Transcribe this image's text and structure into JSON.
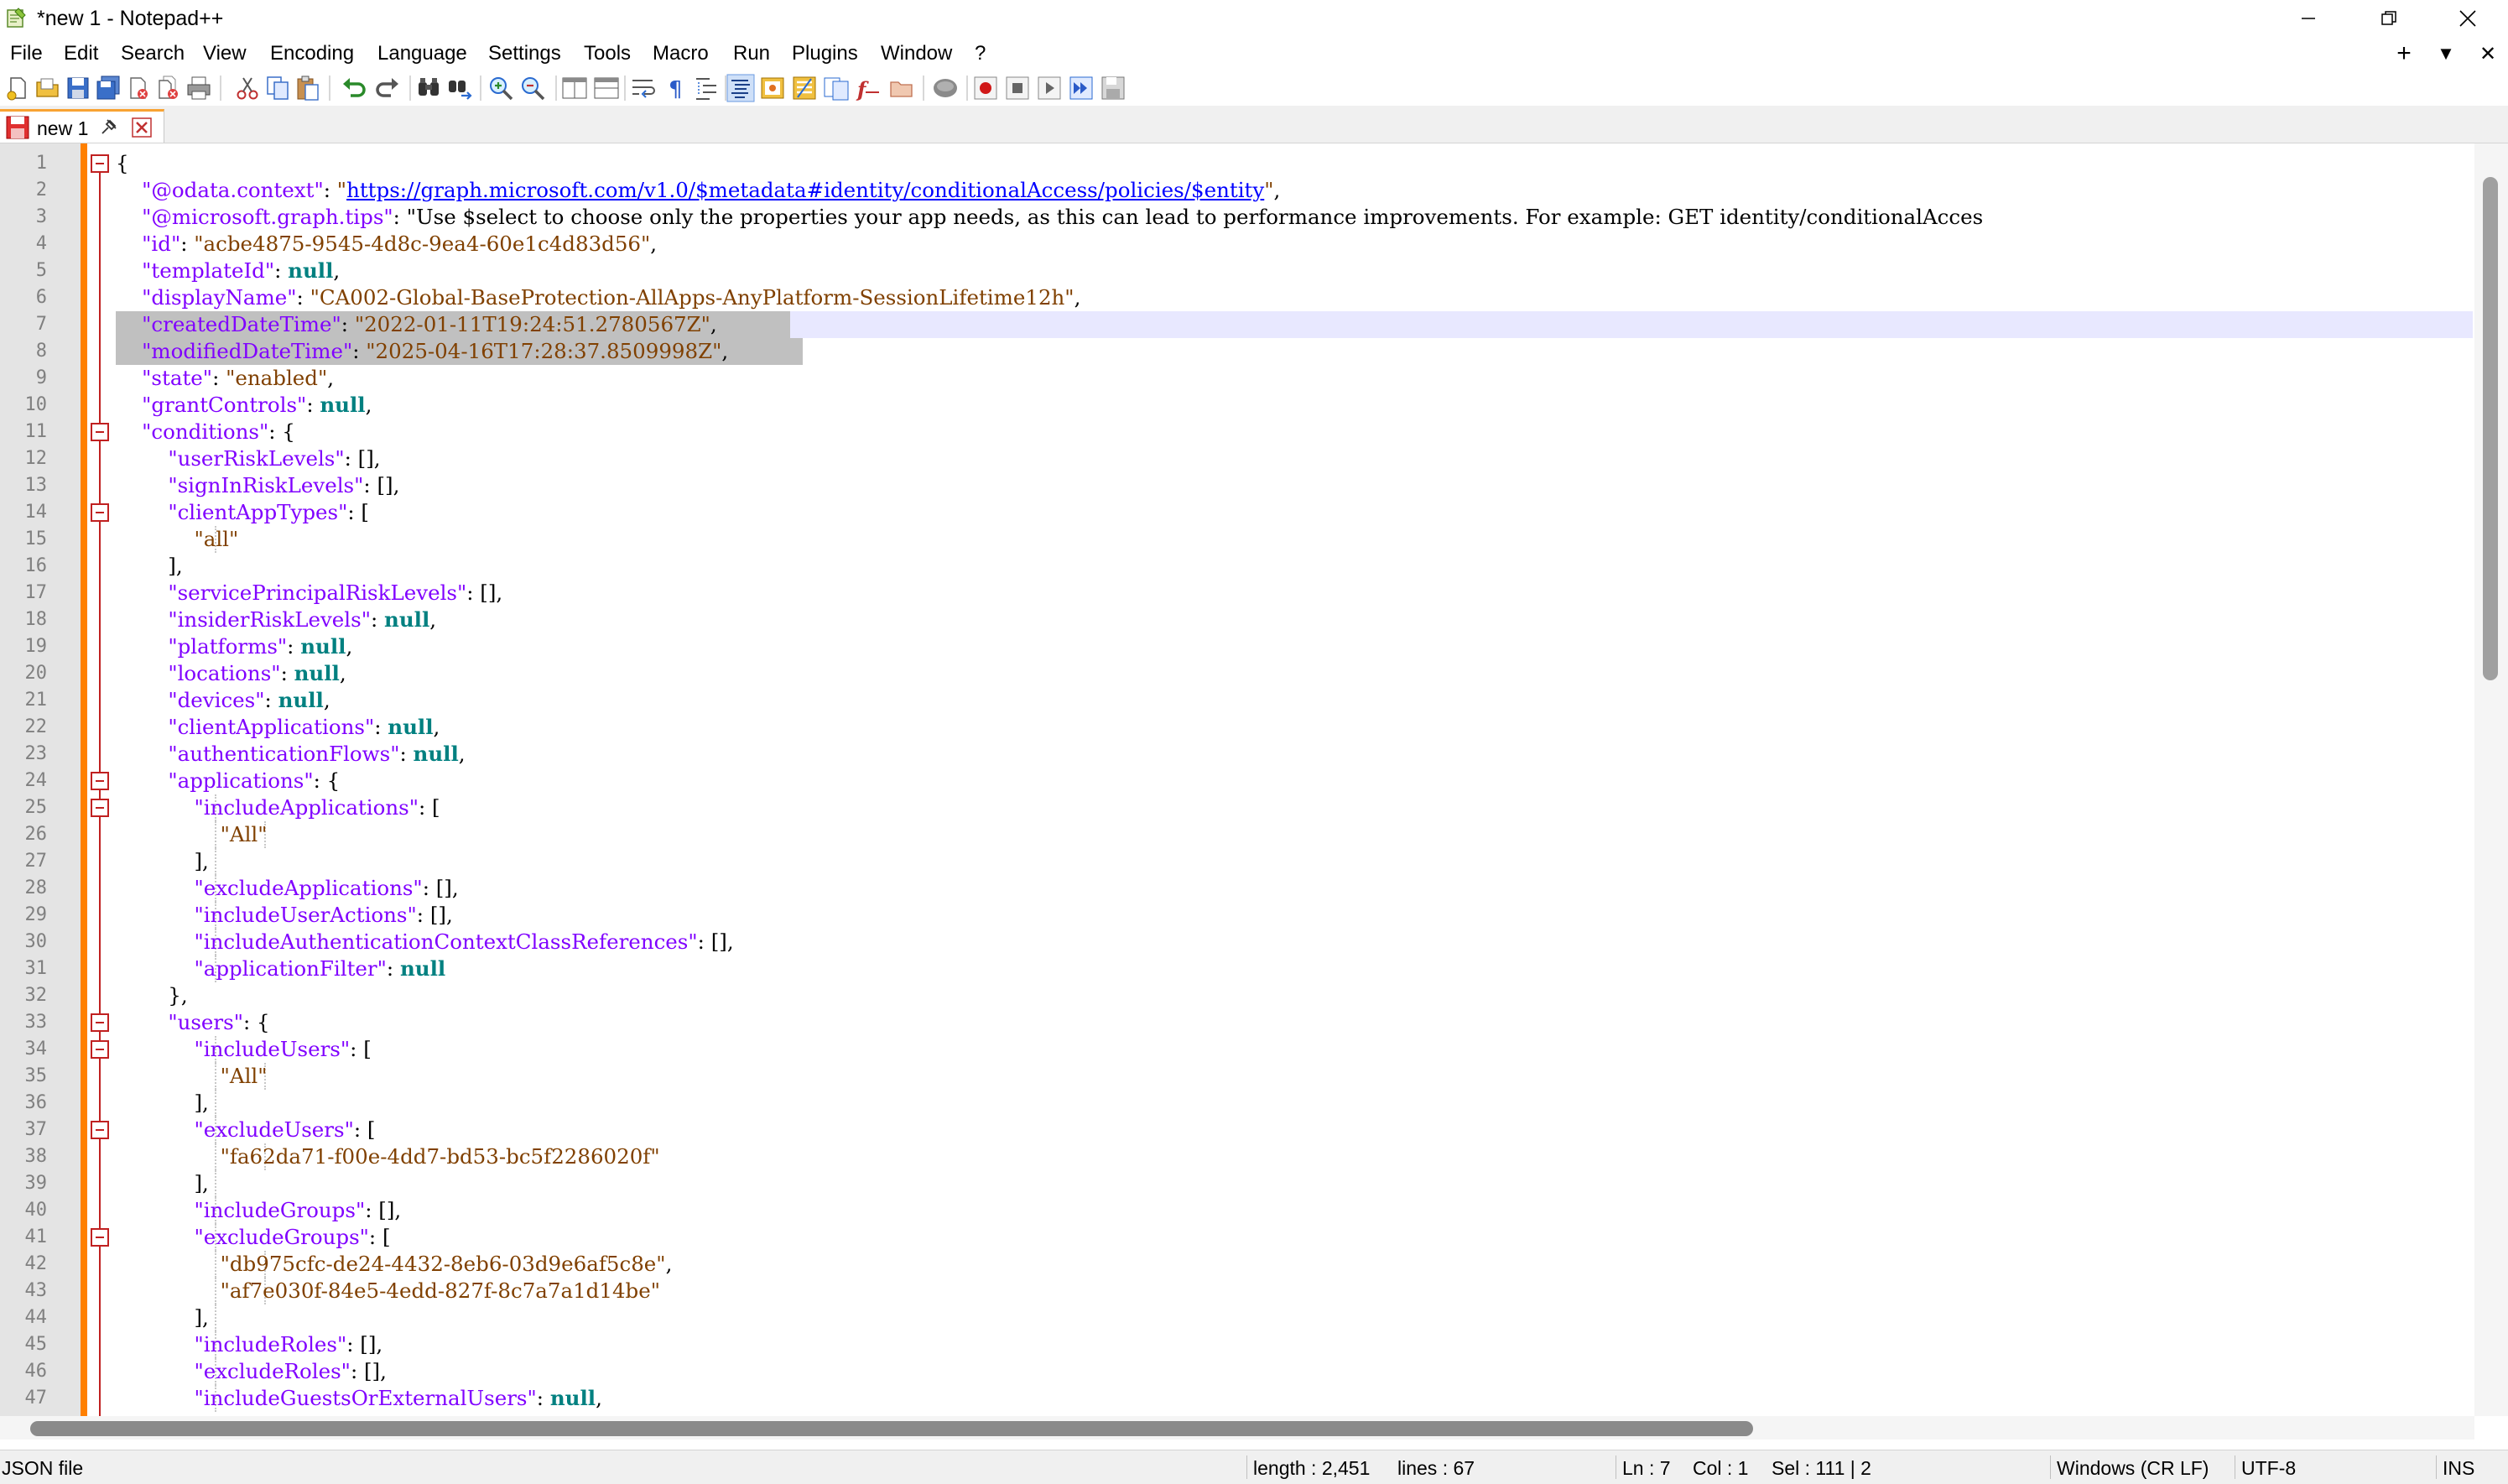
{
  "window": {
    "title": "*new 1 - Notepad++",
    "icon": "notepadpp-icon",
    "controls": [
      "minimize",
      "restore",
      "close"
    ]
  },
  "menu": {
    "items": [
      "File",
      "Edit",
      "Search",
      "View",
      "Encoding",
      "Language",
      "Settings",
      "Tools",
      "Macro",
      "Run",
      "Plugins",
      "Window",
      "?"
    ],
    "right_buttons": [
      "+",
      "▼",
      "✕"
    ]
  },
  "toolbar": {
    "icons": [
      "new-file-icon",
      "open-file-icon",
      "save-icon",
      "save-all-icon",
      "close-icon",
      "close-all-icon",
      "print-icon",
      "cut-icon",
      "copy-icon",
      "paste-icon",
      "undo-icon",
      "redo-icon",
      "find-icon",
      "replace-icon",
      "zoom-in-icon",
      "zoom-out-icon",
      "sync-vertical-icon",
      "sync-horizontal-icon",
      "word-wrap-icon",
      "show-all-chars-icon",
      "indent-guide-icon",
      "udl-icon",
      "doc-map-icon",
      "doc-list-icon",
      "function-list-icon",
      "folder-workspace-icon",
      "monitoring-icon",
      "record-macro-icon",
      "stop-macro-icon",
      "play-macro-icon",
      "run-macro-multiple-icon",
      "save-macro-icon"
    ]
  },
  "tab": {
    "label": "new 1",
    "pin": "pin-icon",
    "close": "tab-close-icon"
  },
  "editor": {
    "lines": [
      {
        "n": "1",
        "t": "{"
      },
      {
        "n": "2",
        "t": "    \"@odata.context\": \"https://graph.microsoft.com/v1.0/$metadata#identity/conditionalAccess/policies/$entity\","
      },
      {
        "n": "3",
        "t": "    \"@microsoft.graph.tips\": \"Use $select to choose only the properties your app needs, as this can lead to performance improvements. For example: GET identity/conditionalAcces"
      },
      {
        "n": "4",
        "t": "    \"id\": \"acbe4875-9545-4d8c-9ea4-60e1c4d83d56\","
      },
      {
        "n": "5",
        "t": "    \"templateId\": null,"
      },
      {
        "n": "6",
        "t": "    \"displayName\": \"CA002-Global-BaseProtection-AllApps-AnyPlatform-SessionLifetime12h\","
      },
      {
        "n": "7",
        "t": "    \"createdDateTime\": \"2022-01-11T19:24:51.2780567Z\","
      },
      {
        "n": "8",
        "t": "    \"modifiedDateTime\": \"2025-04-16T17:28:37.8509998Z\","
      },
      {
        "n": "9",
        "t": "    \"state\": \"enabled\","
      },
      {
        "n": "10",
        "t": "    \"grantControls\": null,"
      },
      {
        "n": "11",
        "t": "    \"conditions\": {"
      },
      {
        "n": "12",
        "t": "        \"userRiskLevels\": [],"
      },
      {
        "n": "13",
        "t": "        \"signInRiskLevels\": [],"
      },
      {
        "n": "14",
        "t": "        \"clientAppTypes\": ["
      },
      {
        "n": "15",
        "t": "            \"all\""
      },
      {
        "n": "16",
        "t": "        ],"
      },
      {
        "n": "17",
        "t": "        \"servicePrincipalRiskLevels\": [],"
      },
      {
        "n": "18",
        "t": "        \"insiderRiskLevels\": null,"
      },
      {
        "n": "19",
        "t": "        \"platforms\": null,"
      },
      {
        "n": "20",
        "t": "        \"locations\": null,"
      },
      {
        "n": "21",
        "t": "        \"devices\": null,"
      },
      {
        "n": "22",
        "t": "        \"clientApplications\": null,"
      },
      {
        "n": "23",
        "t": "        \"authenticationFlows\": null,"
      },
      {
        "n": "24",
        "t": "        \"applications\": {"
      },
      {
        "n": "25",
        "t": "            \"includeApplications\": ["
      },
      {
        "n": "26",
        "t": "                \"All\""
      },
      {
        "n": "27",
        "t": "            ],"
      },
      {
        "n": "28",
        "t": "            \"excludeApplications\": [],"
      },
      {
        "n": "29",
        "t": "            \"includeUserActions\": [],"
      },
      {
        "n": "30",
        "t": "            \"includeAuthenticationContextClassReferences\": [],"
      },
      {
        "n": "31",
        "t": "            \"applicationFilter\": null"
      },
      {
        "n": "32",
        "t": "        },"
      },
      {
        "n": "33",
        "t": "        \"users\": {"
      },
      {
        "n": "34",
        "t": "            \"includeUsers\": ["
      },
      {
        "n": "35",
        "t": "                \"All\""
      },
      {
        "n": "36",
        "t": "            ],"
      },
      {
        "n": "37",
        "t": "            \"excludeUsers\": ["
      },
      {
        "n": "38",
        "t": "                \"fa62da71-f00e-4dd7-bd53-bc5f2286020f\""
      },
      {
        "n": "39",
        "t": "            ],"
      },
      {
        "n": "40",
        "t": "            \"includeGroups\": [],"
      },
      {
        "n": "41",
        "t": "            \"excludeGroups\": ["
      },
      {
        "n": "42",
        "t": "                \"db975cfc-de24-4432-8eb6-03d9e6af5c8e\","
      },
      {
        "n": "43",
        "t": "                \"af7e030f-84e5-4edd-827f-8c7a7a1d14be\""
      },
      {
        "n": "44",
        "t": "            ],"
      },
      {
        "n": "45",
        "t": "            \"includeRoles\": [],"
      },
      {
        "n": "46",
        "t": "            \"excludeRoles\": [],"
      },
      {
        "n": "47",
        "t": "            \"includeGuestsOrExternalUsers\": null,"
      }
    ],
    "caret_line": "7",
    "selected_lines": [
      "7",
      "8"
    ]
  },
  "status": {
    "file_type": "JSON file",
    "length": "length : 2,451",
    "lines": "lines : 67",
    "ln": "Ln : 7",
    "col": "Col : 1",
    "sel": "Sel : 111 | 2",
    "eol": "Windows (CR LF)",
    "encoding": "UTF-8",
    "mode": "INS"
  },
  "colors": {
    "key": "#8000ff",
    "string": "#804000",
    "null": "#008080",
    "url": "#0000ff",
    "change_bar": "#ff8000",
    "selection": "#c0c0c0",
    "caret_line": "#e8e8ff"
  }
}
